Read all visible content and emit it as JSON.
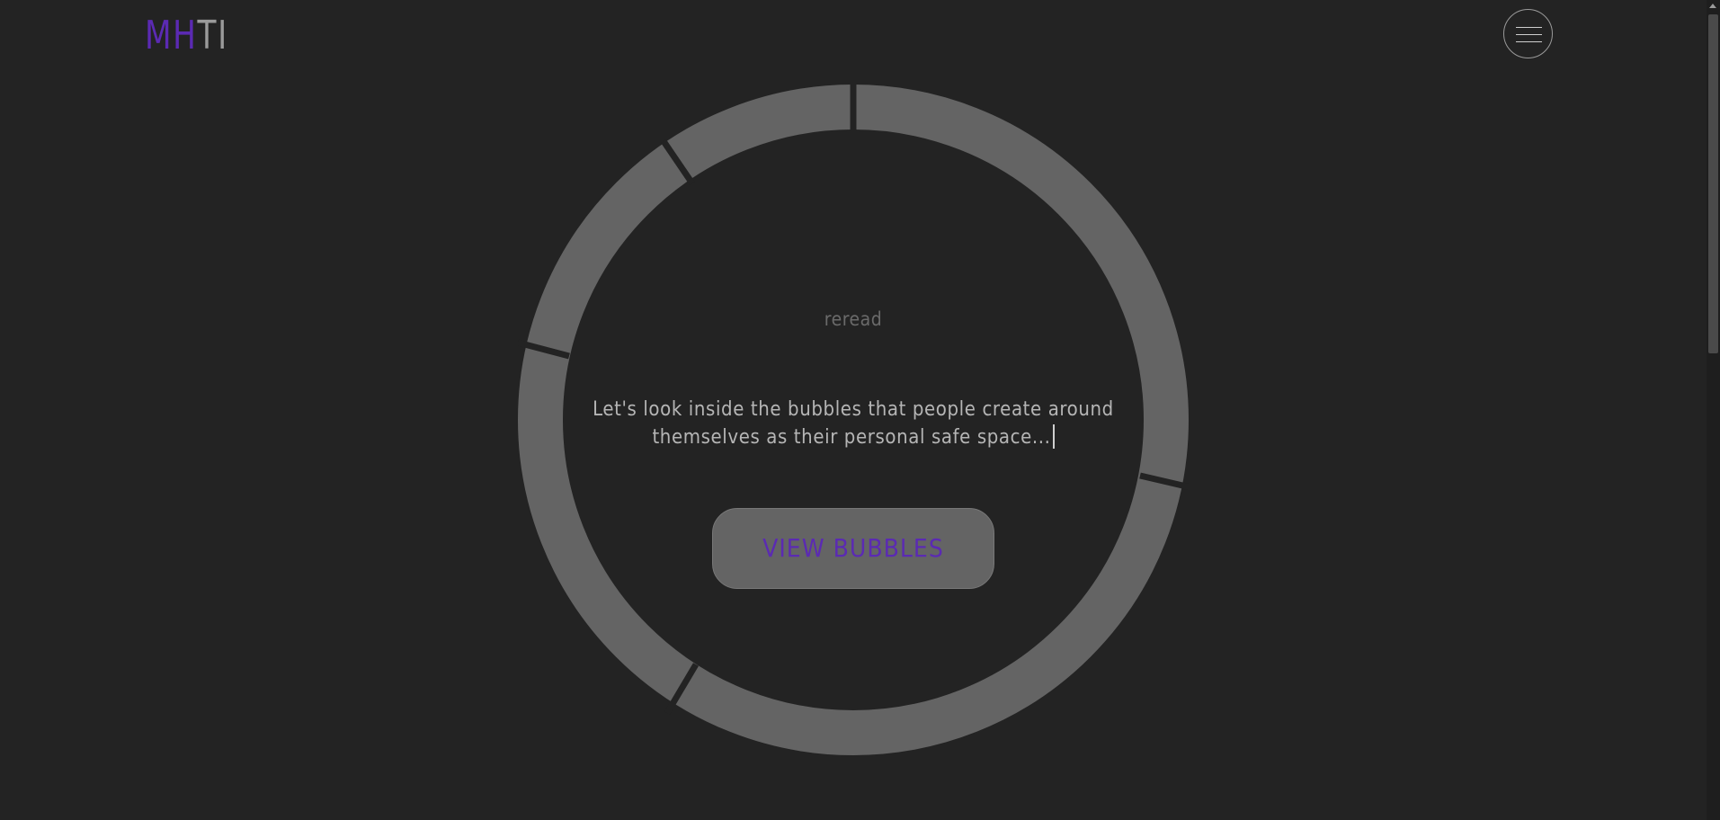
{
  "header": {
    "logo_accent": "MH",
    "logo_plain": "TI"
  },
  "hero": {
    "reread_label": "reread",
    "intro_text": "Let's look inside the bubbles that people create around themselves as their personal safe space...",
    "cta_label": "VIEW BUBBLES"
  },
  "colors": {
    "background": "#232323",
    "accent": "#5b2ab3",
    "ring": "#646464",
    "text": "#b5b5b5",
    "muted_text": "#6a6a6a"
  },
  "icons": {
    "menu": "hamburger-icon"
  }
}
